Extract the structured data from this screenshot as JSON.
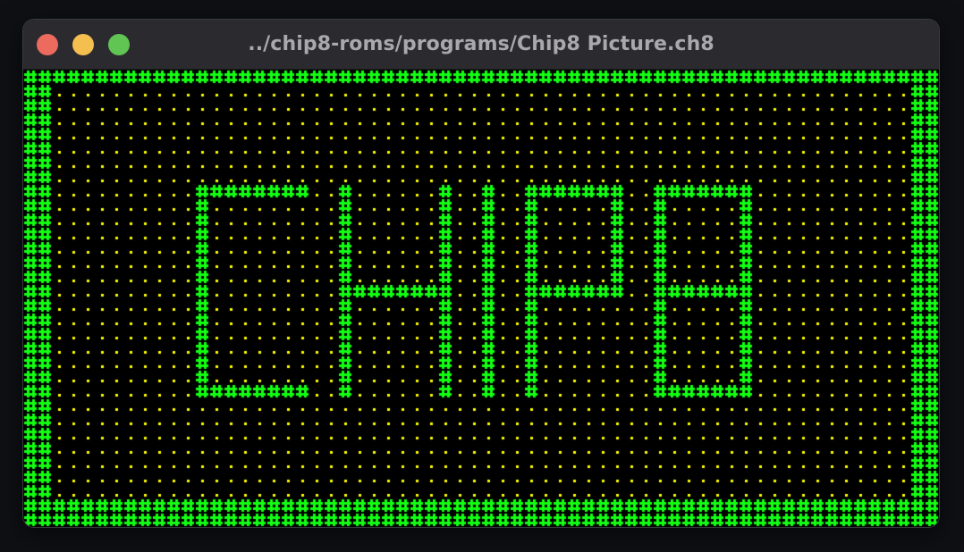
{
  "window": {
    "title": "../chip8-roms/programs/Chip8 Picture.ch8",
    "buttons": [
      {
        "name": "close",
        "color": "#ec6a5e"
      },
      {
        "name": "minimize",
        "color": "#f4bf4f"
      },
      {
        "name": "maximize",
        "color": "#61c554"
      }
    ]
  },
  "display": {
    "columns": 64,
    "rows": 32,
    "on_color": "#12ff12",
    "off_color": "#ffff00",
    "background": "#000000",
    "on_glyph": "#",
    "off_glyph": ".",
    "pixels": [
      "################################################################",
      "##............................................................##",
      "##............................................................##",
      "##............................................................##",
      "##............................................................##",
      "##............................................................##",
      "##............................................................##",
      "##............................................................##",
      "##..........########..#......#..#..#######..#######...........##",
      "##..........#.........#......#..#..#.....#..#.....#...........##",
      "##..........#.........#......#..#..#.....#..#.....#...........##",
      "##..........#.........#......#..#..#.....#..#.....#...........##",
      "##..........#.........#......#..#..#.....#..#.....#...........##",
      "##..........#.........#......#..#..#.....#..#.....#...........##",
      "##..........#.........#......#..#..#.....#..#.....#...........##",
      "##..........#.........########..#..#######..#######...........##",
      "##..........#.........#......#..#..#........#.....#...........##",
      "##..........#.........#......#..#..#........#.....#...........##",
      "##..........#.........#......#..#..#........#.....#...........##",
      "##..........#.........#......#..#..#........#.....#...........##",
      "##..........#.........#......#..#..#........#.....#...........##",
      "##..........#.........#......#..#..#........#.....#...........##",
      "##..........########..#......#..#..#........#######...........##",
      "##............................................................##",
      "##............................................................##",
      "##............................................................##",
      "##............................................................##",
      "##............................................................##",
      "##............................................................##",
      "##............................................................##",
      "################################################################",
      "################################################################"
    ]
  }
}
